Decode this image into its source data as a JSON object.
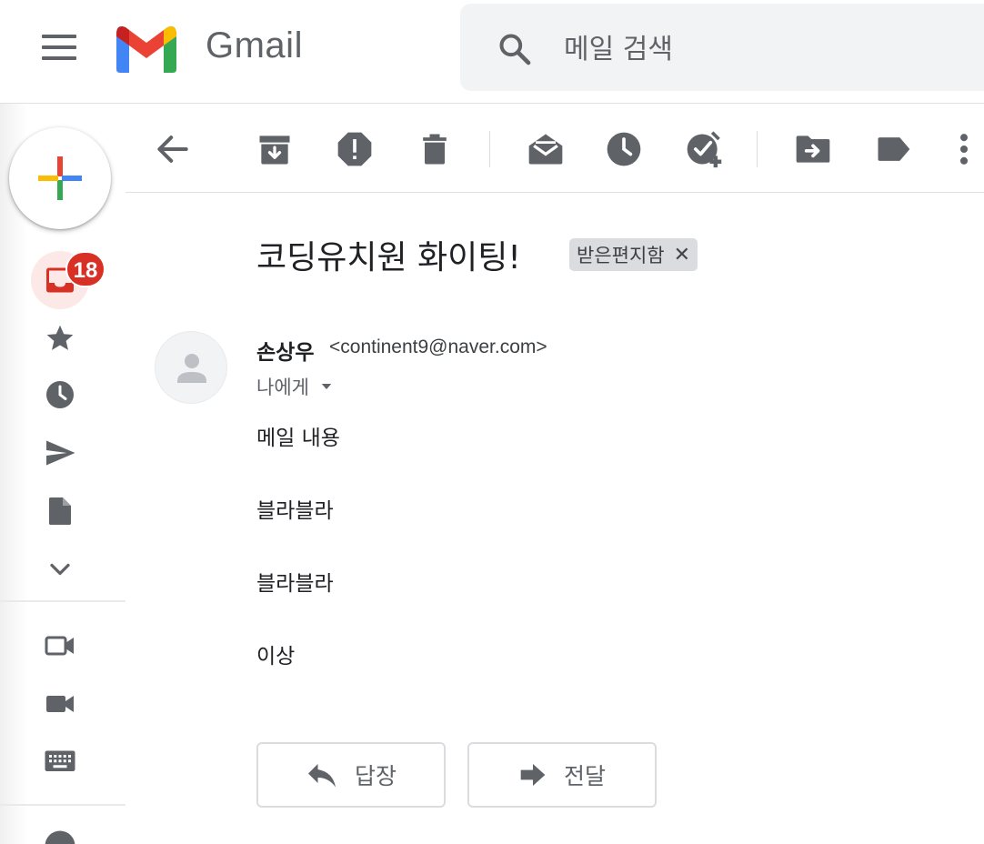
{
  "app": {
    "name": "Gmail"
  },
  "search": {
    "placeholder": "메일 검색"
  },
  "nav": {
    "inbox_unread_count": "18"
  },
  "message": {
    "subject": "코딩유치원 화이팅!",
    "label": "받은편지함",
    "sender": {
      "name": "손상우",
      "email": "<continent9@naver.com>"
    },
    "recipient": "나에게",
    "body": [
      "메일 내용",
      "블라블라",
      "블라블라",
      "이상"
    ]
  },
  "actions": {
    "reply": "답장",
    "forward": "전달"
  },
  "colors": {
    "accent_red": "#d93025",
    "icon_gray": "#5f6368",
    "google_blue": "#4285f4",
    "google_red": "#ea4335",
    "google_yellow": "#fbbc04",
    "google_green": "#34a853"
  }
}
